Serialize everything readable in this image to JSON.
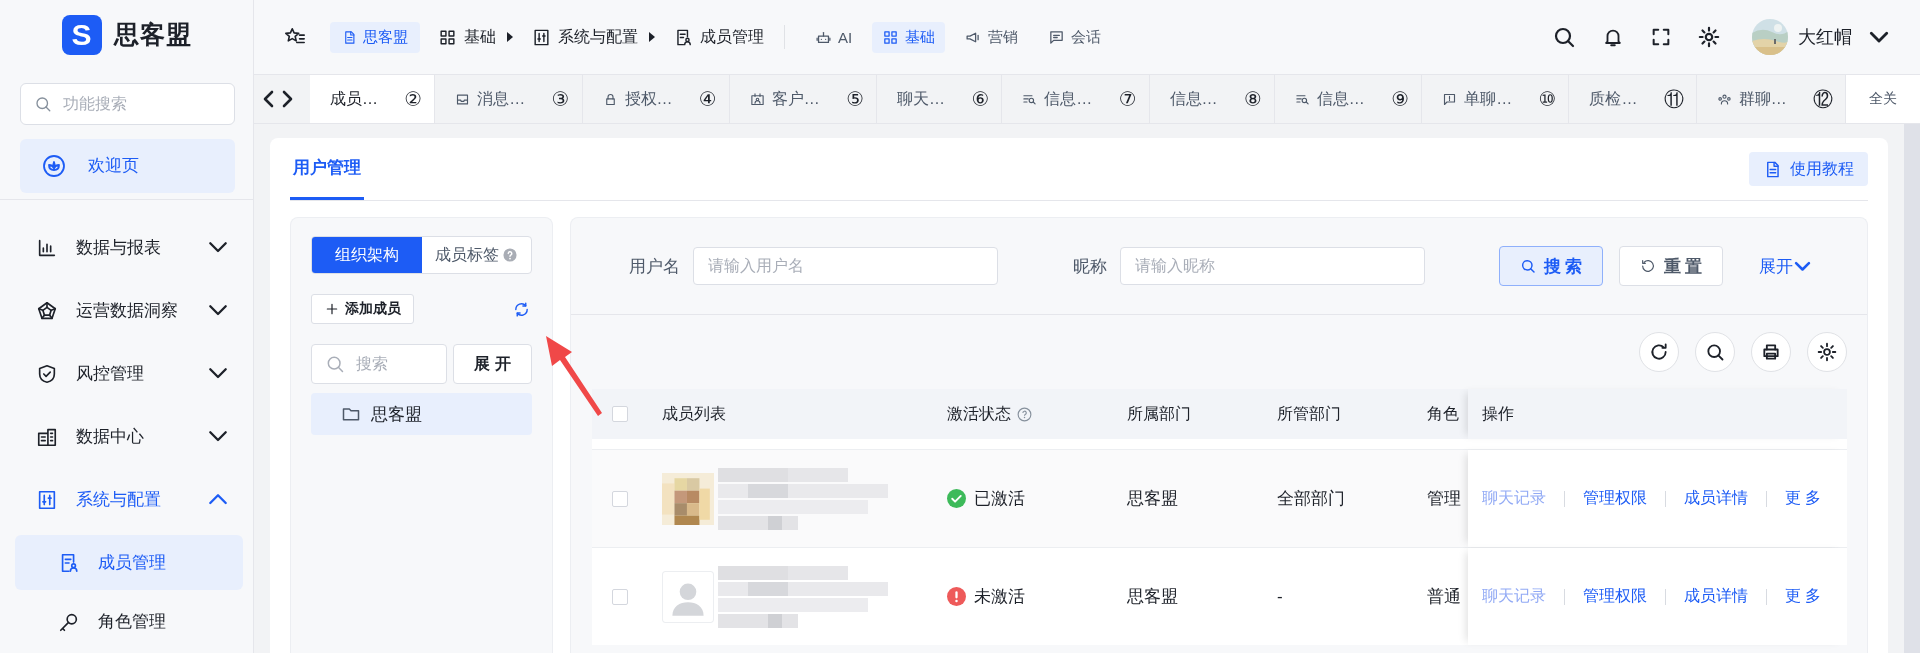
{
  "logo": {
    "mark": "S",
    "name": "思客盟"
  },
  "sidebar": {
    "search": {
      "placeholder": "功能搜索"
    },
    "home": {
      "label": "欢迎页",
      "selected": true
    },
    "items": [
      {
        "label": "数据与报表",
        "expanded": false
      },
      {
        "label": "运营数据洞察",
        "expanded": false
      },
      {
        "label": "风控管理",
        "expanded": false
      },
      {
        "label": "数据中心",
        "expanded": false
      },
      {
        "label": "系统与配置",
        "expanded": true,
        "children": [
          {
            "label": "成员管理",
            "selected": true
          },
          {
            "label": "角色管理",
            "selected": false
          }
        ]
      }
    ]
  },
  "header": {
    "workspace": "思客盟",
    "breadcrumb": [
      "基础",
      "系统与配置",
      "成员管理"
    ],
    "nav": [
      {
        "label": "AI",
        "selected": false
      },
      {
        "label": "基础",
        "selected": true
      },
      {
        "label": "营销",
        "selected": false
      },
      {
        "label": "会话",
        "selected": false
      }
    ],
    "user": {
      "name": "大红帽"
    }
  },
  "tabs": {
    "items": [
      {
        "label": "成员…",
        "number": "②",
        "selected": true
      },
      {
        "label": "消息…",
        "number": "③",
        "selected": false
      },
      {
        "label": "授权…",
        "number": "④",
        "selected": false
      },
      {
        "label": "客户…",
        "number": "⑤",
        "selected": false
      },
      {
        "label": "聊天…",
        "number": "⑥",
        "selected": false
      },
      {
        "label": "信息…",
        "number": "⑦",
        "selected": false
      },
      {
        "label": "信息…",
        "number": "⑧",
        "selected": false
      },
      {
        "label": "信息…",
        "number": "⑨",
        "selected": false
      },
      {
        "label": "单聊…",
        "number": "⑩",
        "selected": false
      },
      {
        "label": "质检…",
        "number": "⑪",
        "selected": false
      },
      {
        "label": "群聊…",
        "number": "⑫",
        "selected": false
      }
    ],
    "close_all": "全关"
  },
  "page": {
    "tabs": [
      {
        "label": "用户管理",
        "selected": true
      }
    ],
    "help_button": "使用教程",
    "org": {
      "segments": [
        {
          "label": "组织架构",
          "selected": true
        },
        {
          "label": "成员标签",
          "selected": false
        }
      ],
      "add_button": "添加成员",
      "search": {
        "placeholder": "搜索"
      },
      "expand_button": "展 开",
      "tree": [
        {
          "label": "思客盟",
          "selected": true
        }
      ]
    },
    "filters": {
      "fields": [
        {
          "label": "用户名",
          "placeholder": "请输入用户名"
        },
        {
          "label": "昵称",
          "placeholder": "请输入昵称"
        }
      ],
      "search_button": "搜 索",
      "reset_button": "重 置",
      "expand_link": "展开"
    },
    "table": {
      "all_checked": false,
      "columns": [
        "成员列表",
        "激活状态",
        "所属部门",
        "所管部门",
        "角色",
        "操作"
      ],
      "rows": [
        {
          "checked": false,
          "avatar": {
            "kind": "picture"
          },
          "status": {
            "label": "已激活",
            "kind": "ok"
          },
          "department": "思客盟",
          "managed": "全部部门",
          "role": "管理",
          "actions": [
            {
              "label": "聊天记录",
              "disabled": true
            },
            {
              "label": "管理权限",
              "disabled": false
            },
            {
              "label": "成员详情",
              "disabled": false
            },
            {
              "label": "更 多",
              "disabled": false
            }
          ]
        },
        {
          "checked": false,
          "avatar": {
            "kind": "silhouette"
          },
          "status": {
            "label": "未激活",
            "kind": "warn"
          },
          "department": "思客盟",
          "managed": "-",
          "role": "普通",
          "actions": [
            {
              "label": "聊天记录",
              "disabled": true
            },
            {
              "label": "管理权限",
              "disabled": false
            },
            {
              "label": "成员详情",
              "disabled": false
            },
            {
              "label": "更 多",
              "disabled": false
            }
          ]
        }
      ]
    }
  }
}
